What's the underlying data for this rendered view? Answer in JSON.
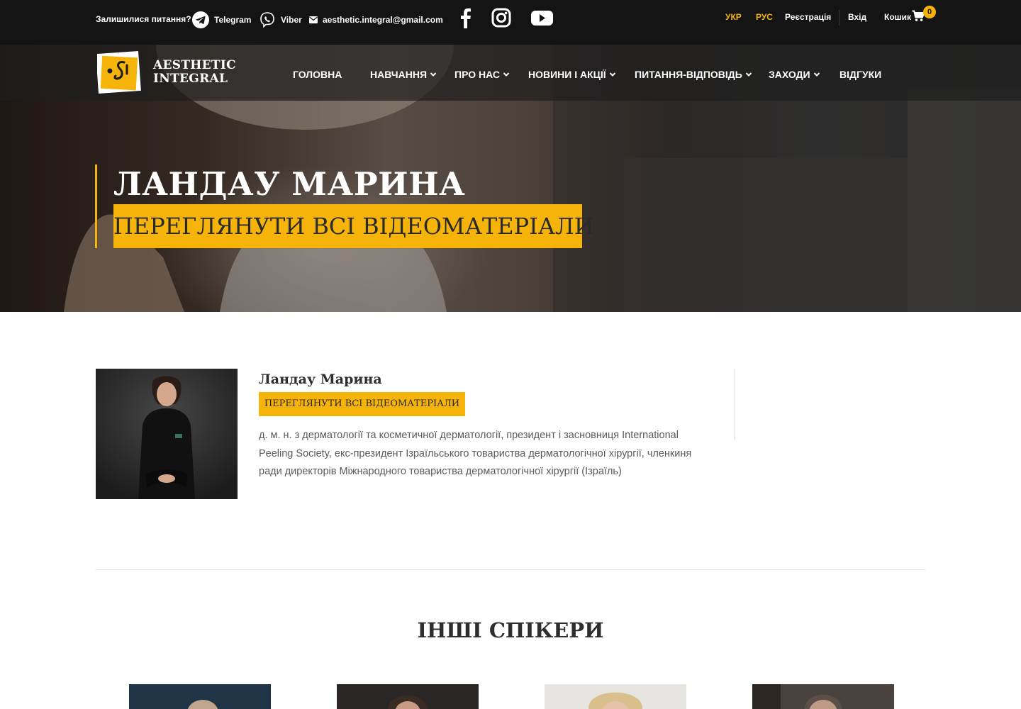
{
  "topbar": {
    "question": "Залишилися питання?",
    "telegram": "Telegram",
    "viber": "Viber",
    "email": "aesthetic.integral@gmail.com",
    "social": [
      "facebook-icon",
      "instagram-icon",
      "youtube-icon"
    ],
    "lang_ukr": "УКР",
    "lang_rus": "РУС",
    "register": "Реєстрація",
    "login": "Вхід",
    "cart": "Кошик",
    "cart_count": "0"
  },
  "brand": {
    "line1": "AESTHETIC",
    "line2": "INTEGRAL",
    "accent": "#f6b40b"
  },
  "nav": {
    "home": "ГОЛОВНА",
    "education": "НАВЧАННЯ",
    "about": "ПРО НАС",
    "news": "НОВИНИ І АКЦІЇ",
    "faq": "ПИТАННЯ-ВІДПОВІДЬ",
    "events": "ЗАХОДИ",
    "reviews": "ВІДГУКИ"
  },
  "hero": {
    "title": "ЛАНДАУ МАРИНА",
    "button": "ПЕРЕГЛЯНУТИ ВСІ ВІДЕОМАТЕРІАЛИ"
  },
  "speaker": {
    "name": "Ландау Марина",
    "button": "ПЕРЕГЛЯНУТИ ВСІ ВІДЕОМАТЕРІАЛИ",
    "description": "д. м. н. з дерматології та косметичної дерматології, президент і засновниця International Peeling Society, екс-президент Ізраїльського товариства дерматологічної хірургії, членкиня ради директорів Міжнародного товариства дерматологічної хірургії (Ізраїль)"
  },
  "others": {
    "title": "ІНШІ СПІКЕРИ"
  }
}
